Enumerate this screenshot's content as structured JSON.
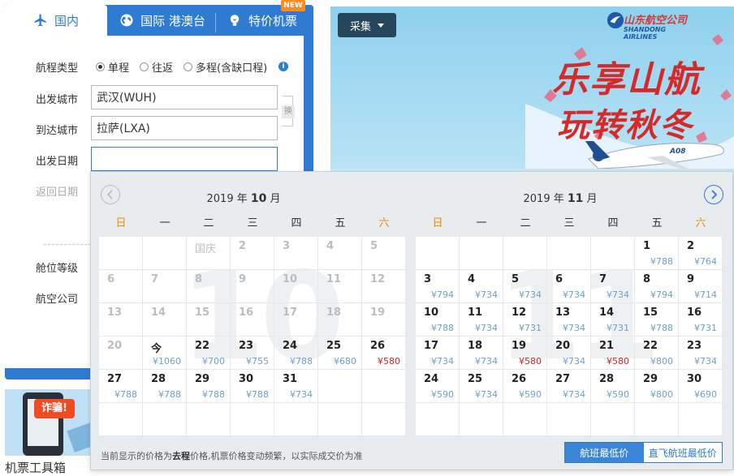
{
  "search": {
    "tabs": [
      {
        "label": "国内",
        "icon": "airplane-icon"
      },
      {
        "label": "国际 港澳台",
        "icon": "globe-icon"
      },
      {
        "label": "特价机票",
        "icon": "bulb-icon"
      }
    ],
    "new_badge": "NEW",
    "trip_type_label": "航程类型",
    "trip_types": [
      "单程",
      "往返",
      "多程(含缺口程)"
    ],
    "from_label": "出发城市",
    "from_value": "武汉(WUH)",
    "to_label": "到达城市",
    "to_value": "拉萨(LXA)",
    "swap_label": "换",
    "depart_label": "出发日期",
    "depart_value": "",
    "return_label": "返回日期",
    "cabin_label": "舱位等级",
    "airline_label": "航空公司"
  },
  "banner": {
    "collect_button": "采集",
    "airline_name_cn": "山东航空公司",
    "airline_name_en": "SHANDONG AIRLINES",
    "slogan_line1": "乐享山航",
    "slogan_line2": "玩转秋冬",
    "plane_text": "A08"
  },
  "tool": {
    "badge": "诈骗!",
    "title": "机票工具箱"
  },
  "calendar": {
    "weekdays": [
      "日",
      "一",
      "二",
      "三",
      "四",
      "五",
      "六"
    ],
    "months": [
      {
        "year_prefix": "2019 年 ",
        "month": "10",
        "month_suffix": " 月",
        "watermark": "10",
        "cells": [
          {
            "d": "",
            "p": ""
          },
          {
            "d": "",
            "p": ""
          },
          {
            "d": "国庆",
            "p": "",
            "s": "hol"
          },
          {
            "d": "2",
            "p": "",
            "s": "dim"
          },
          {
            "d": "3",
            "p": "",
            "s": "dim"
          },
          {
            "d": "4",
            "p": "",
            "s": "dim"
          },
          {
            "d": "5",
            "p": "",
            "s": "dim"
          },
          {
            "d": "6",
            "p": "",
            "s": "dim"
          },
          {
            "d": "7",
            "p": "",
            "s": "dim"
          },
          {
            "d": "8",
            "p": "",
            "s": "dim"
          },
          {
            "d": "9",
            "p": "",
            "s": "dim"
          },
          {
            "d": "10",
            "p": "",
            "s": "dim"
          },
          {
            "d": "11",
            "p": "",
            "s": "dim"
          },
          {
            "d": "12",
            "p": "",
            "s": "dim"
          },
          {
            "d": "13",
            "p": "",
            "s": "dim"
          },
          {
            "d": "14",
            "p": "",
            "s": "dim"
          },
          {
            "d": "15",
            "p": "",
            "s": "dim"
          },
          {
            "d": "16",
            "p": "",
            "s": "dim"
          },
          {
            "d": "17",
            "p": "",
            "s": "dim"
          },
          {
            "d": "18",
            "p": "",
            "s": "dim"
          },
          {
            "d": "19",
            "p": "",
            "s": "dim"
          },
          {
            "d": "20",
            "p": "",
            "s": "dim"
          },
          {
            "d": "今",
            "p": "¥1060"
          },
          {
            "d": "22",
            "p": "¥700"
          },
          {
            "d": "23",
            "p": "¥755"
          },
          {
            "d": "24",
            "p": "¥788"
          },
          {
            "d": "25",
            "p": "¥680"
          },
          {
            "d": "26",
            "p": "¥580",
            "low": true
          },
          {
            "d": "27",
            "p": "¥788"
          },
          {
            "d": "28",
            "p": "¥788"
          },
          {
            "d": "29",
            "p": "¥788"
          },
          {
            "d": "30",
            "p": "¥788"
          },
          {
            "d": "31",
            "p": "¥734"
          },
          {
            "d": "",
            "p": ""
          },
          {
            "d": "",
            "p": ""
          },
          {
            "d": "",
            "p": ""
          },
          {
            "d": "",
            "p": ""
          },
          {
            "d": "",
            "p": ""
          },
          {
            "d": "",
            "p": ""
          },
          {
            "d": "",
            "p": ""
          },
          {
            "d": "",
            "p": ""
          },
          {
            "d": "",
            "p": ""
          }
        ]
      },
      {
        "year_prefix": "2019 年 ",
        "month": "11",
        "month_suffix": " 月",
        "watermark": "11",
        "cells": [
          {
            "d": "",
            "p": ""
          },
          {
            "d": "",
            "p": ""
          },
          {
            "d": "",
            "p": ""
          },
          {
            "d": "",
            "p": ""
          },
          {
            "d": "",
            "p": ""
          },
          {
            "d": "1",
            "p": "¥788"
          },
          {
            "d": "2",
            "p": "¥764"
          },
          {
            "d": "3",
            "p": "¥794"
          },
          {
            "d": "4",
            "p": "¥734"
          },
          {
            "d": "5",
            "p": "¥734"
          },
          {
            "d": "6",
            "p": "¥734"
          },
          {
            "d": "7",
            "p": "¥734"
          },
          {
            "d": "8",
            "p": "¥794"
          },
          {
            "d": "9",
            "p": "¥714"
          },
          {
            "d": "10",
            "p": "¥788"
          },
          {
            "d": "11",
            "p": "¥734"
          },
          {
            "d": "12",
            "p": "¥731"
          },
          {
            "d": "13",
            "p": "¥734"
          },
          {
            "d": "14",
            "p": "¥731"
          },
          {
            "d": "15",
            "p": "¥788"
          },
          {
            "d": "16",
            "p": "¥731"
          },
          {
            "d": "17",
            "p": "¥734"
          },
          {
            "d": "18",
            "p": "¥734"
          },
          {
            "d": "19",
            "p": "¥580",
            "low": true
          },
          {
            "d": "20",
            "p": "¥734"
          },
          {
            "d": "21",
            "p": "¥580",
            "low": true
          },
          {
            "d": "22",
            "p": "¥800"
          },
          {
            "d": "23",
            "p": "¥734"
          },
          {
            "d": "24",
            "p": "¥590"
          },
          {
            "d": "25",
            "p": "¥734"
          },
          {
            "d": "26",
            "p": "¥590"
          },
          {
            "d": "27",
            "p": "¥734"
          },
          {
            "d": "28",
            "p": "¥590"
          },
          {
            "d": "29",
            "p": "¥800"
          },
          {
            "d": "30",
            "p": "¥690"
          },
          {
            "d": "",
            "p": ""
          },
          {
            "d": "",
            "p": ""
          },
          {
            "d": "",
            "p": ""
          },
          {
            "d": "",
            "p": ""
          },
          {
            "d": "",
            "p": ""
          },
          {
            "d": "",
            "p": ""
          },
          {
            "d": "",
            "p": ""
          }
        ]
      }
    ],
    "footer_pre": "当前显示的价格为",
    "footer_bold": "去程",
    "footer_post": "价格,机票价格变动频繁，以实际成交价为准",
    "toggle_lowest": "航班最低价",
    "toggle_direct": "直飞航班最低价"
  }
}
